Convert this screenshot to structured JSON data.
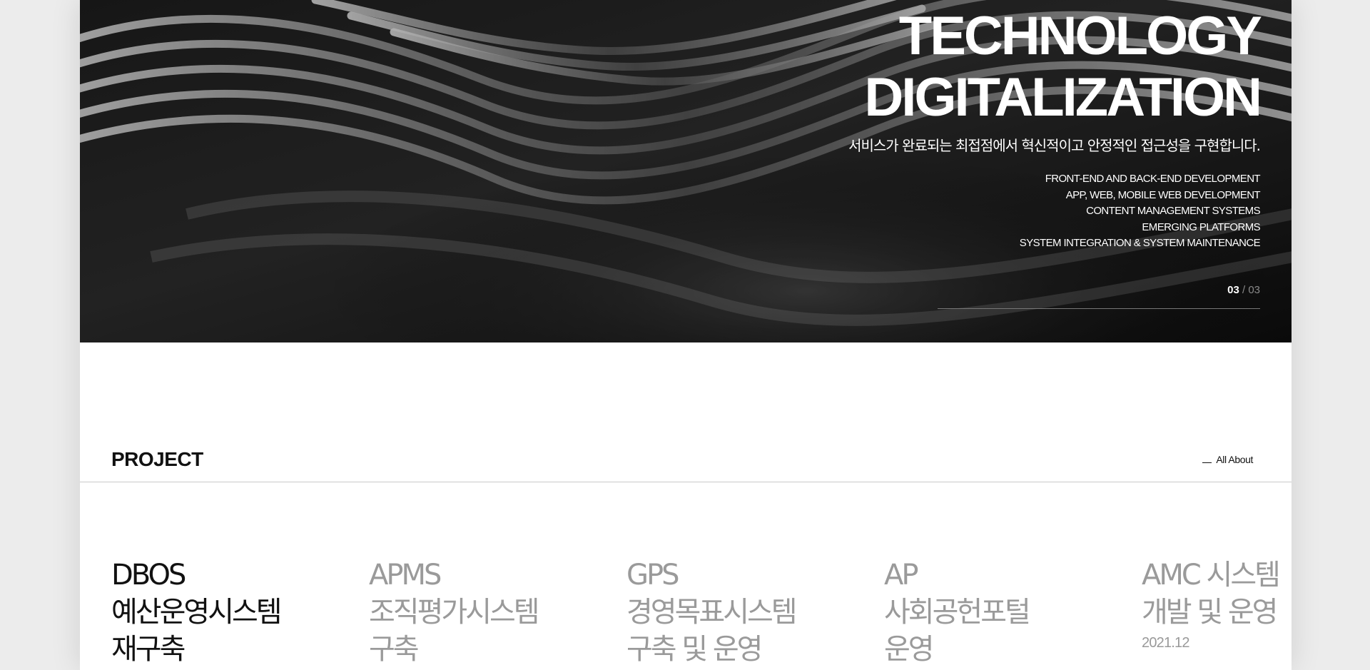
{
  "hero": {
    "title_line1": "TECHNOLOGY",
    "title_line2": "DIGITALIZATION",
    "subtitle": "서비스가 완료되는 최접점에서 혁신적이고 안정적인 접근성을 구현합니다.",
    "services": [
      "FRONT-END AND BACK-END DEVELOPMENT",
      "APP, WEB, MOBILE WEB DEVELOPMENT",
      "CONTENT MANAGEMENT SYSTEMS",
      "EMERGING PLATFORMS",
      "SYSTEM INTEGRATION & SYSTEM MAINTENANCE"
    ],
    "pager": {
      "current": "03",
      "separator": "/",
      "total": "03"
    }
  },
  "project_section": {
    "title": "PROJECT",
    "all_about_label": "All About",
    "items": [
      {
        "code": "DBOS",
        "name": "예산운영시스템\n재구축",
        "date": ""
      },
      {
        "code": "APMS",
        "name": "조직평가시스템\n구축",
        "date": ""
      },
      {
        "code": "GPS",
        "name": "경영목표시스템\n구축 및 운영",
        "date": ""
      },
      {
        "code": "AP",
        "name": "사회공헌포털\n운영",
        "date": ""
      },
      {
        "code": "AMC 시스템",
        "name": "개발 및 운영",
        "date": "2021.12"
      }
    ]
  },
  "colors": {
    "hero_background": "#101010",
    "text_primary": "#111111",
    "text_muted": "#9a9a9a",
    "page_background": "#ffffff",
    "outer_background": "#ececec"
  }
}
